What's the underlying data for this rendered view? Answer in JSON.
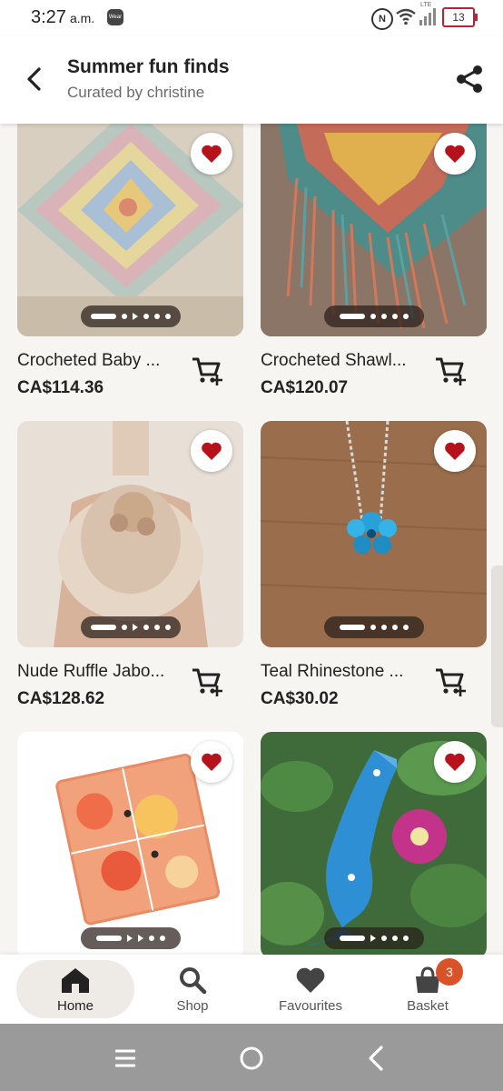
{
  "status": {
    "time": "3:27",
    "ampm": "a.m.",
    "wear": "Wear",
    "nfc": "N",
    "lte": "LTE",
    "battery": "13"
  },
  "header": {
    "title": "Summer fun finds",
    "subtitle": "Curated by christine"
  },
  "products": [
    {
      "name": "Crocheted Baby ...",
      "price": "CA$114.36"
    },
    {
      "name": "Crocheted Shawl...",
      "price": "CA$120.07"
    },
    {
      "name": "Nude Ruffle Jabo...",
      "price": "CA$128.62"
    },
    {
      "name": "Teal Rhinestone ...",
      "price": "CA$30.02"
    },
    {
      "name": "",
      "price": ""
    },
    {
      "name": "",
      "price": ""
    }
  ],
  "nav": [
    {
      "label": "Home",
      "icon": "home-icon",
      "active": true
    },
    {
      "label": "Shop",
      "icon": "search-icon"
    },
    {
      "label": "Favourites",
      "icon": "heart-icon"
    },
    {
      "label": "Basket",
      "icon": "basket-icon",
      "badge": "3"
    }
  ],
  "colors": {
    "accent": "#222222",
    "heart": "#b5121b",
    "badge": "#d9532a",
    "background": "#f6f5f2"
  }
}
